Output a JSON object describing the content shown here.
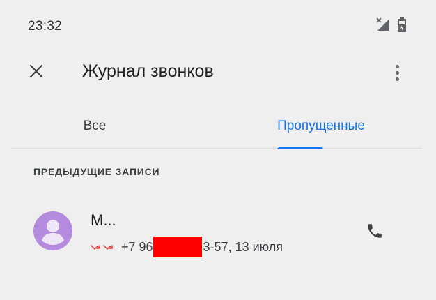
{
  "status_bar": {
    "time": "23:32",
    "icons": [
      "signal-no-service-icon",
      "battery-icon"
    ]
  },
  "app_bar": {
    "title": "Журнал звонков",
    "close_icon": "close-icon",
    "menu_icon": "more-vert-icon"
  },
  "tabs": [
    {
      "label": "Все",
      "selected": false
    },
    {
      "label": "Пропущенные",
      "selected": true
    }
  ],
  "colors": {
    "accent": "#1a73e8",
    "missed_call": "#e53935",
    "avatar_bg": "#b58bdf",
    "redaction": "#ff0000"
  },
  "section": {
    "header": "ПРЕДЫДУЩИЕ ЗАПИСИ"
  },
  "calls": [
    {
      "name": "М...",
      "call_type_icons": [
        "missed-call-icon",
        "missed-call-icon"
      ],
      "number_prefix": "+7 96",
      "number_suffix": "3-57, 13 июля",
      "action_icon": "phone-icon"
    }
  ]
}
